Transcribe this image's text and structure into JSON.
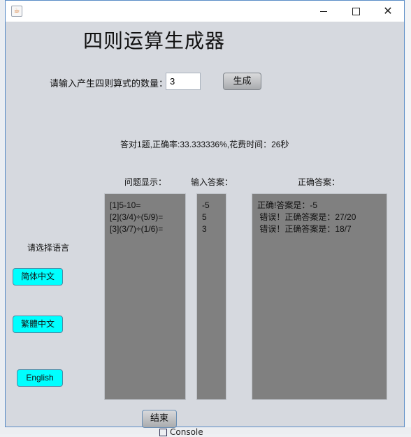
{
  "window": {
    "app_icon": "java-cup-icon",
    "controls": {
      "minimize": "minimize-icon",
      "maximize": "maximize-icon",
      "close": "close-icon"
    }
  },
  "main": {
    "title": "四则运算生成器",
    "count_prompt": "请输入产生四则算式的数量：",
    "count_value": "3",
    "generate_label": "生成",
    "result_summary": "答对1题,正确率:33.333336%,花费时间：26秒",
    "questions_label": "问题显示：",
    "answers_label": "输入答案：",
    "correct_label": "正确答案：",
    "questions": [
      "[1]5-10=",
      "[2](3/4)÷(5/9)=",
      "[3](3/7)÷(1/6)="
    ],
    "answers": [
      "-5",
      "5",
      "3"
    ],
    "correct": [
      "正确!答案是：-5",
      " 错误！正确答案是：27/20",
      " 错误！正确答案是：18/7"
    ],
    "end_label": "结束"
  },
  "language": {
    "label": "请选择语言",
    "simplified": "简体中文",
    "traditional": "繁體中文",
    "english": "English",
    "button_color": "#00ffff"
  },
  "background": {
    "console_tab": "Console"
  }
}
